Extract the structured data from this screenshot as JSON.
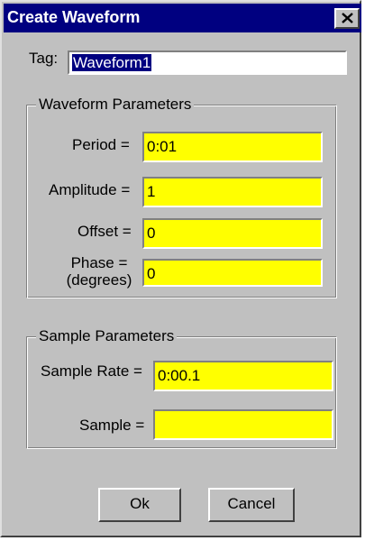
{
  "window": {
    "title": "Create Waveform",
    "close_icon": "close-icon"
  },
  "tag": {
    "label": "Tag:",
    "value": "Waveform1"
  },
  "waveform_parameters": {
    "title": "Waveform Parameters",
    "period_label": "Period =",
    "period_value": "0:01",
    "amplitude_label": "Amplitude =",
    "amplitude_value": "1",
    "offset_label": "Offset =",
    "offset_value": "0",
    "phase_label_line1": "Phase =",
    "phase_label_line2": "(degrees)",
    "phase_value": "0"
  },
  "sample_parameters": {
    "title": "Sample Parameters",
    "sample_rate_label": "Sample Rate =",
    "sample_rate_value": "0:00.1",
    "sample_label": "Sample =",
    "sample_value": ""
  },
  "buttons": {
    "ok_label": "Ok",
    "cancel_label": "Cancel"
  },
  "colors": {
    "title_bar": "#000080",
    "dialog_face": "#c0c0c0",
    "field_highlight": "#ffff00"
  }
}
